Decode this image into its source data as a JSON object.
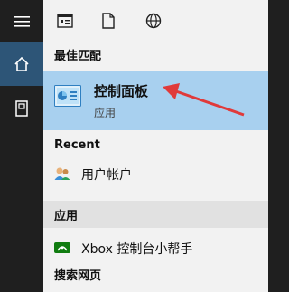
{
  "rail": {
    "items": [
      {
        "icon": "hamburger-menu-icon"
      },
      {
        "icon": "home-icon"
      },
      {
        "icon": "notebook-icon"
      }
    ],
    "active_color": "#2d5577"
  },
  "topbar": {
    "icons": [
      "apps-icon",
      "document-icon",
      "web-globe-icon"
    ]
  },
  "best_match": {
    "header": "最佳匹配",
    "title": "控制面板",
    "subtitle": "应用",
    "highlight_color": "#a8d0ef"
  },
  "recent": {
    "header": "Recent",
    "items": [
      {
        "label": "用户帐户",
        "icon": "user-accounts-icon"
      }
    ]
  },
  "apps": {
    "header": "应用",
    "items": [
      {
        "label": "Xbox 控制台小帮手",
        "icon": "xbox-icon"
      }
    ]
  },
  "web": {
    "header": "搜索网页"
  },
  "annotation": {
    "color": "#e03a3a"
  }
}
